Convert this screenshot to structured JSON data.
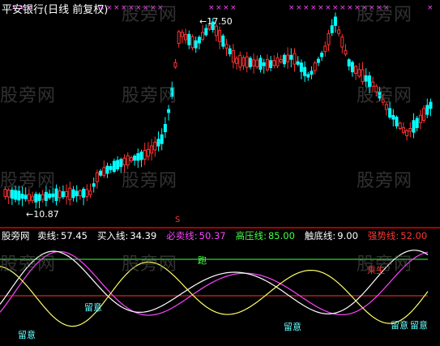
{
  "title": "平安银行(日线 前复权)",
  "top_chart": {
    "high_label": "17.50",
    "low_label": "10.87"
  },
  "legend": {
    "name": "股旁网",
    "items": [
      {
        "label": "卖线:",
        "value": "57.45",
        "color": "#ffffff"
      },
      {
        "label": "买入线:",
        "value": "34.39",
        "color": "#ffffff"
      },
      {
        "label": "必卖线:",
        "value": "50.37",
        "color": "#ff44ff"
      },
      {
        "label": "高压线:",
        "value": "85.00",
        "color": "#44ff44"
      },
      {
        "label": "触底线:",
        "value": "9.00",
        "color": "#ffffff"
      },
      {
        "label": "强势线:",
        "value": "52.00",
        "color": "#ff3333"
      }
    ]
  },
  "signals": {
    "pao": "跑",
    "liuyi": "留意",
    "qiangshi": "乘生",
    "top_marker": "S"
  },
  "watermark": "股旁网",
  "colors": {
    "up": "#ff3333",
    "down": "#00ffff",
    "sell_line": "#ffffff",
    "buy_line": "#ffff66",
    "must_sell": "#ff44ff",
    "high_pressure": "#44ff44",
    "strong": "#ff3333"
  }
}
